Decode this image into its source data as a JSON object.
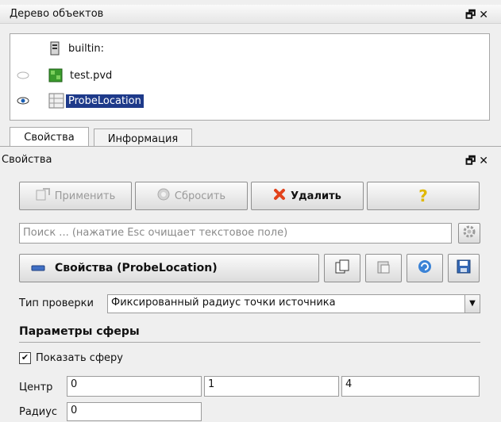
{
  "pipeline_panel": {
    "title": "Дерево объектов",
    "float_glyph": "🗗",
    "close_glyph": "✕",
    "items": [
      {
        "label": "builtin:",
        "icon": "server-icon"
      },
      {
        "label": "test.pvd",
        "icon": "dataset-icon"
      },
      {
        "label": "ProbeLocation",
        "icon": "filter-icon"
      }
    ]
  },
  "tabs": [
    {
      "label": "Свойства",
      "active": true
    },
    {
      "label": "Информация",
      "active": false
    }
  ],
  "properties_panel": {
    "title": "Свойства",
    "float_glyph": "🗗",
    "close_glyph": "✕",
    "apply_label": "Применить",
    "reset_label": "Сбросить",
    "delete_label": "Удалить",
    "help_label": "?",
    "search_placeholder": "Поиск ... (нажатие Esc очищает текстовое поле)",
    "group_title": "Свойства (ProbeLocation)",
    "probe_type_label": "Тип проверки",
    "probe_type_value": "Фиксированный радиус точки источника",
    "sphere_section_title": "Параметры сферы",
    "show_sphere_label": "Показать сферу",
    "show_sphere_checked": true,
    "center_label": "Центр",
    "center_values": [
      "0",
      "1",
      "4"
    ],
    "radius_label": "Радиус",
    "radius_value": "0"
  },
  "colors": {
    "selection": "#1e3a8a",
    "delete_icon": "#e2421b",
    "help_icon": "#e0b800",
    "visible_eye": "#1a5fb4",
    "dataset_green": "#3a9b2c"
  }
}
